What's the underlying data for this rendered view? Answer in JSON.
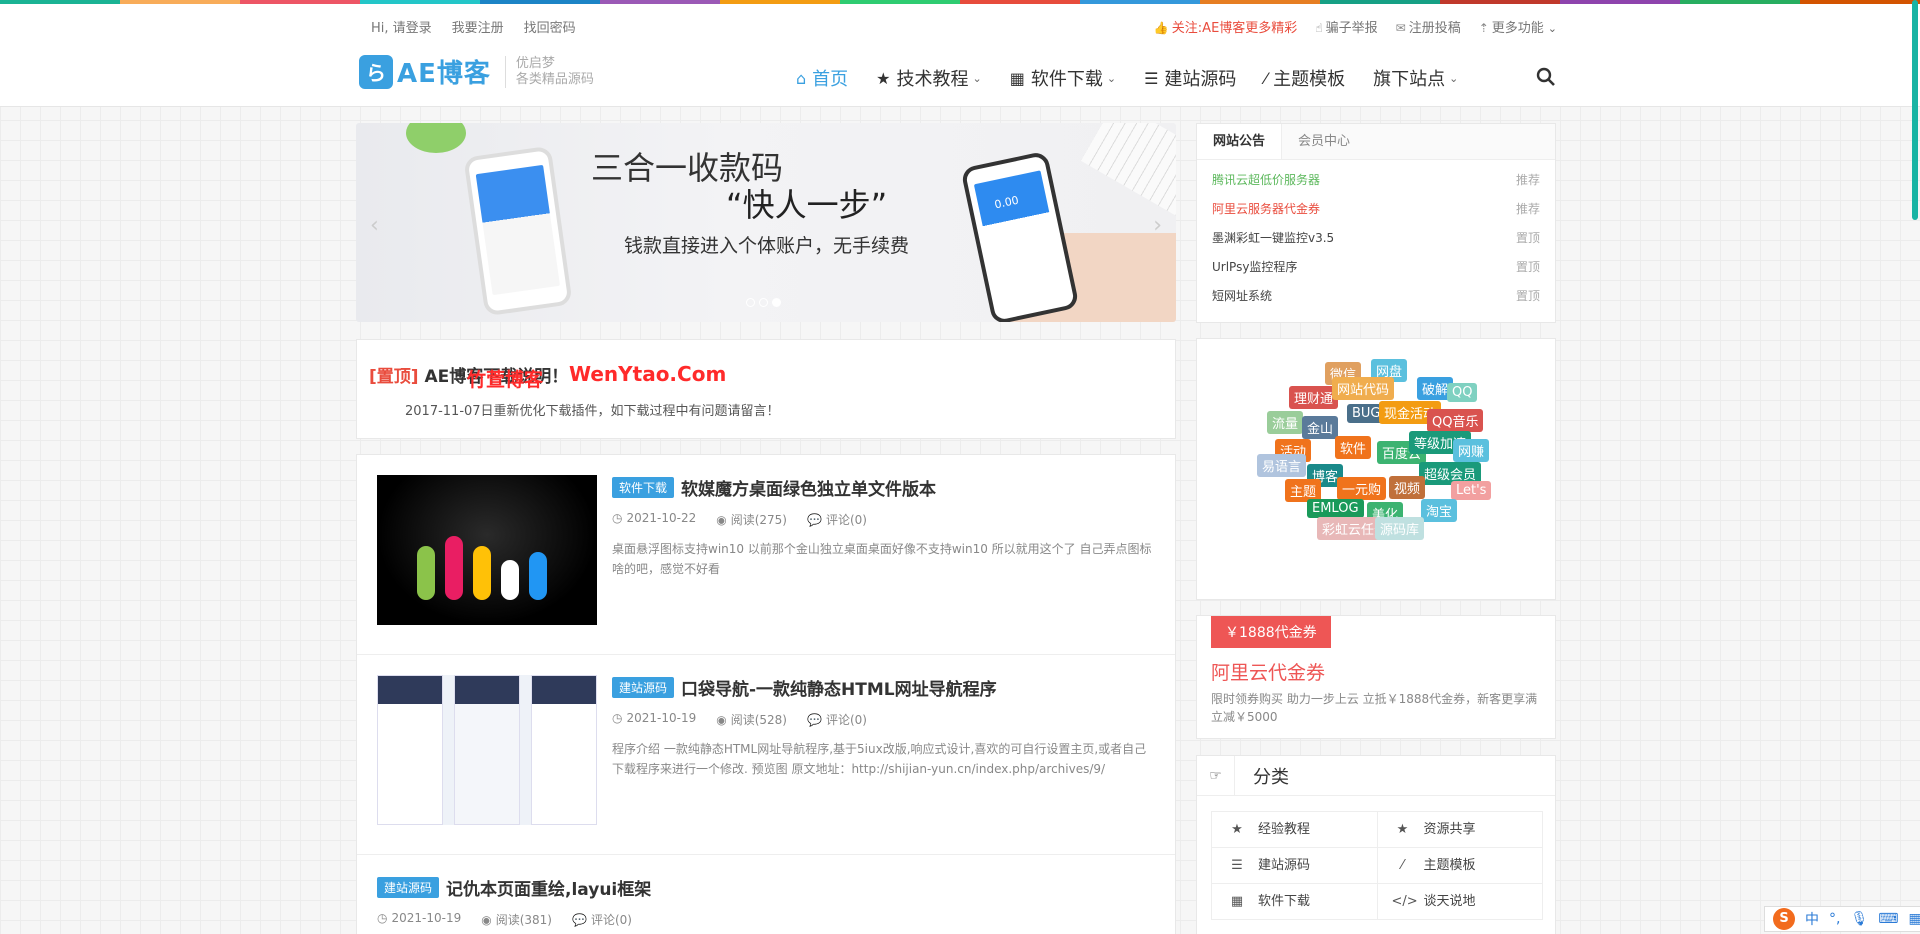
{
  "colors": {
    "accent": "#3aa0e0",
    "red": "#e94c3d",
    "promo": "#ee5655",
    "rainbow": [
      "#1ab394",
      "#f8ac59",
      "#ed5565",
      "#23c6c8",
      "#1c84c6",
      "#9b59b6",
      "#f39c12",
      "#2ecc71",
      "#e74c3c",
      "#3498db",
      "#e67e22",
      "#16a085",
      "#c0392b",
      "#8e44ad",
      "#27ae60",
      "#d35400"
    ]
  },
  "topbar": {
    "links_left": [
      "Hi, 请登录",
      "我要注册",
      "找回密码"
    ],
    "follow": "关注:AE博客更多精彩",
    "report": "骗子举报",
    "submit": "注册投稿",
    "more": "更多功能"
  },
  "logo": {
    "mark": "ら",
    "text": "AE博客",
    "sub1": "优启梦",
    "sub2": "各类精品源码"
  },
  "nav": {
    "items": [
      {
        "label": "首页",
        "icon": "home-icon"
      },
      {
        "label": "技术教程",
        "icon": "star-icon"
      },
      {
        "label": "软件下载",
        "icon": "grid-icon"
      },
      {
        "label": "建站源码",
        "icon": "list-icon"
      },
      {
        "label": "主题模板",
        "icon": "magic-wand-icon"
      },
      {
        "label": "旗下站点",
        "icon": ""
      }
    ]
  },
  "banner": {
    "line1": "三合一收款码",
    "line2": "“快人一步”",
    "line3": "钱款直接进入个体账户，无手续费",
    "phone_amount": "0.00",
    "slide_count": 3,
    "active_slide": 3
  },
  "notice": {
    "tag": "[置顶]",
    "title": "AE博客下载说明！",
    "watermark1": "竹萱博客",
    "watermark2": "WenYtao.Com",
    "body": "2017-11-07日重新优化下载插件，如下载过程中有问题请留言！"
  },
  "posts": [
    {
      "category": "软件下载",
      "title": "软媒魔方桌面绿色独立单文件版本",
      "date": "2021-10-22",
      "views": "阅读(275)",
      "comments": "评论(0)",
      "excerpt": "桌面悬浮图标支持win10 以前那个金山独立桌面桌面好像不支持win10 所以就用这个了 自己弄点图标啥的吧，感觉不好看"
    },
    {
      "category": "建站源码",
      "title": "口袋导航-一款纯静态HTML网址导航程序",
      "date": "2021-10-19",
      "views": "阅读(528)",
      "comments": "评论(0)",
      "excerpt": "程序介绍 一款纯静态HTML网址导航程序,基于5iux改版,响应式设计,喜欢的可自行设置主页,或者自己下载程序来进行一个修改. 预览图 原文地址：http://shijian-yun.cn/index.php/archives/9/"
    },
    {
      "category": "建站源码",
      "title": "记仇本页面重绘,layui框架",
      "date": "2021-10-19",
      "views": "阅读(381)",
      "comments": "评论(0)",
      "excerpt": ""
    }
  ],
  "sidebar": {
    "tabs": [
      "网站公告",
      "会员中心"
    ],
    "announcements": [
      {
        "text": "腾讯云超低价服务器",
        "badge": "推荐",
        "color": "#5cb85c"
      },
      {
        "text": "阿里云服务器代金券",
        "badge": "推荐",
        "color": "#e94c3d"
      },
      {
        "text": "墨渊彩虹一键监控v3.5",
        "badge": "置顶",
        "color": "#444444"
      },
      {
        "text": "UrlPsy监控程序",
        "badge": "置顶",
        "color": "#444444"
      },
      {
        "text": "短网址系统",
        "badge": "置顶",
        "color": "#444444"
      }
    ],
    "tags": [
      {
        "t": "微信",
        "c": "#e0a060"
      },
      {
        "t": "网盘",
        "c": "#5bc0de"
      },
      {
        "t": "理财通",
        "c": "#d9534f"
      },
      {
        "t": "网站代码",
        "c": "#f0ad4e"
      },
      {
        "t": "破解",
        "c": "#3aa0e0"
      },
      {
        "t": "QQ",
        "c": "#7fd1c1"
      },
      {
        "t": "流量",
        "c": "#9acd9a"
      },
      {
        "t": "金山",
        "c": "#5a7a9a"
      },
      {
        "t": "BUG",
        "c": "#4a6f8a"
      },
      {
        "t": "现金活动",
        "c": "#f39c12"
      },
      {
        "t": "QQ音乐",
        "c": "#d9534f"
      },
      {
        "t": "活动",
        "c": "#f0731c"
      },
      {
        "t": "软件",
        "c": "#f0731c"
      },
      {
        "t": "百度云",
        "c": "#3cb371"
      },
      {
        "t": "等级加速",
        "c": "#1a9a7a"
      },
      {
        "t": "网赚",
        "c": "#5bc0de"
      },
      {
        "t": "易语言",
        "c": "#b0c4de"
      },
      {
        "t": "博客",
        "c": "#1a8a8a"
      },
      {
        "t": "超级会员",
        "c": "#1a9a7a"
      },
      {
        "t": "主题",
        "c": "#f0731c"
      },
      {
        "t": "一元购",
        "c": "#f0731c"
      },
      {
        "t": "视频",
        "c": "#c0703a"
      },
      {
        "t": "Let's",
        "c": "#f2a0a0"
      },
      {
        "t": "EMLOG",
        "c": "#1a9a5a"
      },
      {
        "t": "美化",
        "c": "#3cb371"
      },
      {
        "t": "淘宝",
        "c": "#5bc0de"
      },
      {
        "t": "彩虹云任务",
        "c": "#e8b8b8"
      },
      {
        "t": "源码库",
        "c": "#bfe0e0"
      }
    ],
    "promo": {
      "button": "￥1888代金券",
      "title": "阿里云代金券",
      "desc": "限时领券购买 助力一步上云 立抵￥1888代金券，新客更享满立减￥5000"
    },
    "categories_title": "分类",
    "categories": [
      {
        "label": "经验教程",
        "icon": "star-icon",
        "g": "★"
      },
      {
        "label": "资源共享",
        "icon": "star-icon",
        "g": "★"
      },
      {
        "label": "建站源码",
        "icon": "list-icon",
        "g": "☰"
      },
      {
        "label": "主题模板",
        "icon": "magic-wand-icon",
        "g": "⁄"
      },
      {
        "label": "软件下载",
        "icon": "grid-icon",
        "g": "▦"
      },
      {
        "label": "谈天说地",
        "icon": "code-icon",
        "g": "</>"
      }
    ]
  },
  "ime": {
    "logo": "S",
    "lang": "中"
  }
}
